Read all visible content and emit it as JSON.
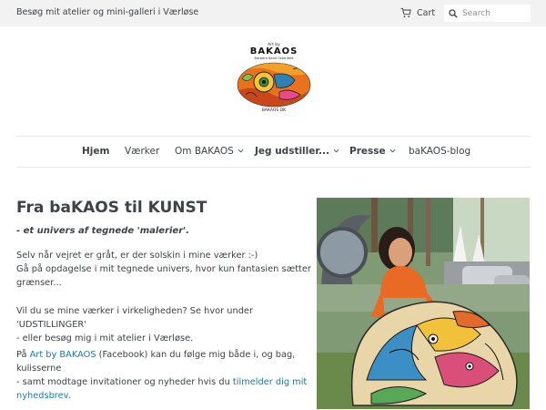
{
  "header": {
    "announcement": "Besøg mit atelier og mini-galleri i Værløse",
    "cart_label": "Cart",
    "search_placeholder": "Search"
  },
  "logo": {
    "art_by": "Art by",
    "brand": "BAKAOS",
    "subtitle": "Barbara Kaad Ostenfeld",
    "domain": "BAKAOS.DK"
  },
  "nav": {
    "items": [
      {
        "label": "Hjem"
      },
      {
        "label": "Værker"
      },
      {
        "label": "Om BAKAOS"
      },
      {
        "label": "Jeg udstiller..."
      },
      {
        "label": "Presse"
      },
      {
        "label": "baKAOS-blog"
      }
    ]
  },
  "main": {
    "title": "Fra baKAOS til KUNST",
    "tagline": "- et univers af tegnede 'malerier'.",
    "p1_line1": "Selv når vejret er gråt, er der solskin i mine værker :-)",
    "p1_line2": "Gå på opdagelse i mit tegnede univers, hvor kun fantasien sætter grænser...",
    "p2_line1": "Vil du se mine værker i virkeligheden? Se hvor under 'UDSTILLINGER'",
    "p2_line2": "- eller besøg mig i mit atelier i Værløse.",
    "p3_pre": "På ",
    "p3_link": "Art by BAKAOS",
    "p3_post": " (Facebook) kan du følge mig både i, og bag, kulisserne",
    "p4_pre": "- samt modtage invitationer og nyheder hvis du ",
    "p4_link": "tilmelder dig mit nyhedsbrev",
    "p4_post": "."
  },
  "colors": {
    "topbar_bg": "#f2f2f2",
    "text": "#3d4246",
    "link": "#1a79a8",
    "divider": "#e8e9eb"
  }
}
